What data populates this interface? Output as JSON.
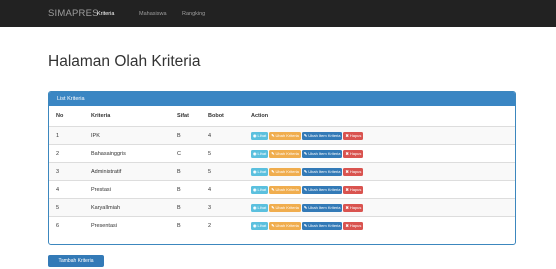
{
  "navbar": {
    "brand": "SIMAPRES",
    "links": [
      "Kriteria",
      "Mahasiswa",
      "Rangking"
    ]
  },
  "page": {
    "title": "Halaman Olah Kriteria"
  },
  "panel": {
    "heading": "List Kriteria",
    "columns": [
      "No",
      "Kriteria",
      "Sifat",
      "Bobot",
      "Action"
    ],
    "actions": {
      "view": "Lihat",
      "edit": "Ubah Kriteria",
      "edit_items": "Ubah Item Kriteria",
      "delete": "Hapus"
    },
    "icons": {
      "view": "eye-icon",
      "edit": "edit-icon",
      "edit_items": "edit-icon",
      "delete": "times-icon"
    },
    "rows": [
      {
        "no": "1",
        "kriteria": "IPK",
        "sifat": "B",
        "bobot": "4"
      },
      {
        "no": "2",
        "kriteria": "Bahasainggris",
        "sifat": "C",
        "bobot": "5"
      },
      {
        "no": "3",
        "kriteria": "Administratif",
        "sifat": "B",
        "bobot": "5"
      },
      {
        "no": "4",
        "kriteria": "Prestasi",
        "sifat": "B",
        "bobot": "4"
      },
      {
        "no": "5",
        "kriteria": "KaryaIlmiah",
        "sifat": "B",
        "bobot": "3"
      },
      {
        "no": "6",
        "kriteria": "Presentasi",
        "sifat": "B",
        "bobot": "2"
      }
    ]
  },
  "add_button": "Tambah Kriteria",
  "colors": {
    "navbar": "#222222",
    "panel_heading": "#3a86c3",
    "btn_info": "#5bc0de",
    "btn_warning": "#f0ad4e",
    "btn_primary": "#337ab7",
    "btn_danger": "#d9534f"
  }
}
